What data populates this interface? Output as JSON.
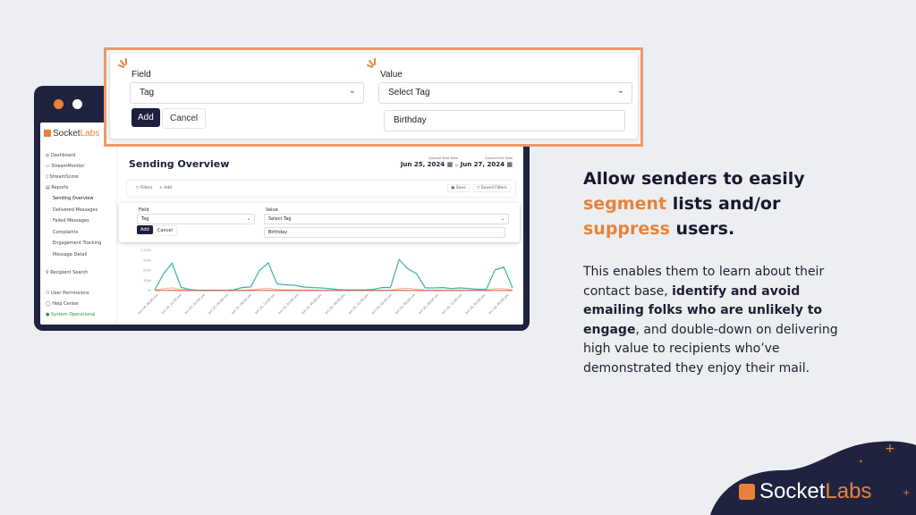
{
  "callout": {
    "field_label": "Field",
    "field_value": "Tag",
    "value_label": "Value",
    "value_select": "Select Tag",
    "value_input": "Birthday",
    "add_label": "Add",
    "cancel_label": "Cancel"
  },
  "app": {
    "brand": {
      "socket": "Socket",
      "labs": "Labs"
    },
    "sidebar": {
      "items": [
        {
          "label": "Dashboard"
        },
        {
          "label": "StreamMonitor"
        },
        {
          "label": "StreamScore"
        },
        {
          "label": "Reports"
        }
      ],
      "sub_items": [
        {
          "label": "Sending Overview"
        },
        {
          "label": "Delivered Messages"
        },
        {
          "label": "Failed Messages"
        },
        {
          "label": "Complaints"
        },
        {
          "label": "Engagement Tracking"
        },
        {
          "label": "Message Detail"
        }
      ],
      "bottom": [
        {
          "label": "Recipient Search"
        },
        {
          "label": "User Permissions"
        },
        {
          "label": "Help Center"
        },
        {
          "label": "System Operational"
        }
      ]
    },
    "page_title": "Sending Overview",
    "start_label": "Queued Start Date",
    "start_date": "Jun 25, 2024",
    "to": "to",
    "end_label": "Queued End Date",
    "end_date": "Jun 27, 2024",
    "filters": "Filters",
    "add": "+ Add",
    "save": "Save",
    "saved_filters": "Saved Filters",
    "panel": {
      "field_label": "Field",
      "field_value": "Tag",
      "value_label": "Value",
      "value_select": "Select Tag",
      "value_input": "Birthday",
      "add_label": "Add",
      "cancel_label": "Cancel"
    }
  },
  "chart_data": {
    "type": "line",
    "yticks": [
      "1,200k",
      "900k",
      "600k",
      "300k",
      "0k"
    ],
    "ylim": [
      0,
      1200
    ],
    "xticks": [
      "Jun 24, 08:00 pm",
      "Jun 24, 11:00 pm",
      "Jun 25, 02:00 am",
      "Jun 25, 05:00 am",
      "Jun 25, 08:00 am",
      "Jun 25, 11:00 am",
      "Jun 25, 02:00 pm",
      "Jun 25, 05:00 pm",
      "Jun 25, 08:00 pm",
      "Jun 25, 11:00 pm",
      "Jun 26, 02:00 am",
      "Jun 26, 05:00 am",
      "Jun 26, 08:00 am",
      "Jun 26, 11:00 am",
      "Jun 26, 02:00 pm",
      "Jun 26, 05:00 pm"
    ],
    "series": [
      {
        "color": "#3cb4a6",
        "values": [
          20,
          500,
          820,
          100,
          30,
          10,
          10,
          10,
          5,
          20,
          90,
          110,
          600,
          830,
          200,
          170,
          160,
          110,
          90,
          80,
          60,
          30,
          20,
          20,
          20,
          30,
          90,
          90,
          930,
          650,
          500,
          80,
          80,
          90,
          60,
          80,
          60,
          40,
          40,
          620,
          700,
          80
        ]
      },
      {
        "color": "#f2b48a",
        "values": [
          10,
          60,
          80,
          40,
          10,
          5,
          5,
          5,
          5,
          5,
          10,
          20,
          50,
          70,
          30,
          20,
          20,
          15,
          10,
          10,
          10,
          5,
          5,
          5,
          5,
          5,
          10,
          10,
          60,
          70,
          40,
          10,
          10,
          10,
          10,
          10,
          10,
          10,
          10,
          60,
          60,
          10
        ]
      },
      {
        "color": "#e0483c",
        "values": [
          2,
          5,
          6,
          4,
          2,
          2,
          2,
          2,
          2,
          2,
          2,
          3,
          5,
          6,
          4,
          3,
          3,
          3,
          2,
          2,
          2,
          2,
          2,
          2,
          2,
          2,
          2,
          2,
          6,
          5,
          4,
          2,
          2,
          2,
          2,
          2,
          2,
          2,
          2,
          5,
          5,
          2
        ]
      }
    ]
  },
  "slide": {
    "h_1": "Allow senders to easily",
    "h_seg": "segment",
    "h_2": " lists and/or",
    "h_sup": "suppress",
    "h_3": " users.",
    "p_1": "This enables them to learn about their contact base, ",
    "p_b1": "identify and avoid emailing folks who are unlikely to engage",
    "p_2": ", and double-down on delivering high value to recipients who’ve demonstrated they enjoy their mail."
  },
  "footer_logo": {
    "socket": "Socket",
    "labs": "Labs"
  },
  "colors": {
    "accent": "#e8823a",
    "navy": "#20233f",
    "teal": "#3cb4a6"
  }
}
